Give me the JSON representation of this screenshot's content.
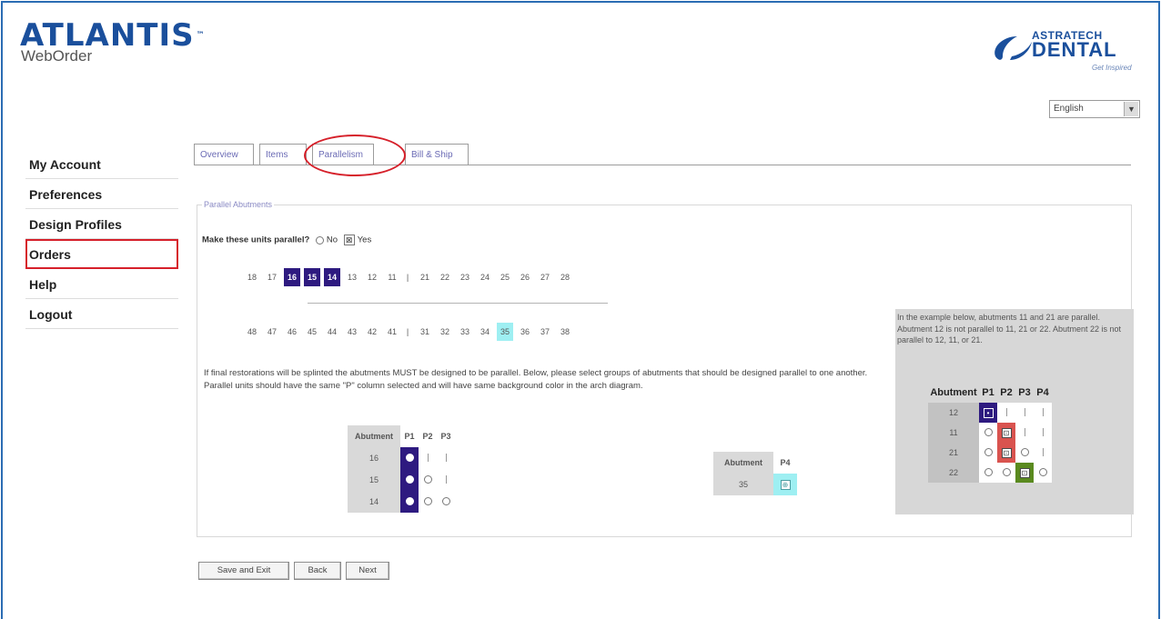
{
  "app": {
    "logo_name": "ATLANTIS",
    "logo_tm": "™",
    "logo_sub": "WebOrder",
    "partner_logo_line1": "ASTRATECH",
    "partner_logo_line2": "DENTAL",
    "partner_logo_tagline": "Get Inspired"
  },
  "language": {
    "selected": "English"
  },
  "sidebar": {
    "items": [
      {
        "label": "My Account"
      },
      {
        "label": "Preferences"
      },
      {
        "label": "Design Profiles"
      },
      {
        "label": "Orders",
        "active": true
      },
      {
        "label": "Help"
      },
      {
        "label": "Logout"
      }
    ]
  },
  "tabs": [
    {
      "label": "Overview"
    },
    {
      "label": "Items"
    },
    {
      "label": "Parallelism",
      "active": true
    },
    {
      "label": "Bill & Ship"
    }
  ],
  "panel": {
    "legend": "Parallel Abutments",
    "question": "Make these units parallel?",
    "option_no": "No",
    "option_yes": "Yes",
    "option_yes_checked": true
  },
  "teeth": {
    "upper": [
      "18",
      "17",
      "16",
      "15",
      "14",
      "13",
      "12",
      "11",
      "|",
      "21",
      "22",
      "23",
      "24",
      "25",
      "26",
      "27",
      "28"
    ],
    "upper_selected": [
      "16",
      "15",
      "14"
    ],
    "lower": [
      "48",
      "47",
      "46",
      "45",
      "44",
      "43",
      "42",
      "41",
      "|",
      "31",
      "32",
      "33",
      "34",
      "35",
      "36",
      "37",
      "38"
    ],
    "lower_selected": [
      "35"
    ]
  },
  "instruction": "If final restorations will be splinted the abutments MUST be designed to be parallel. Below, please select groups of abutments that should be designed parallel to one another. Parallel units should have the same \"P\" column selected and will have same background color in the arch diagram.",
  "grid1": {
    "header": [
      "Abutment",
      "P1",
      "P2",
      "P3"
    ],
    "rows": [
      {
        "abutment": "16"
      },
      {
        "abutment": "15"
      },
      {
        "abutment": "14"
      }
    ]
  },
  "grid2": {
    "header": [
      "Abutment",
      "P4"
    ],
    "rows": [
      {
        "abutment": "35"
      }
    ]
  },
  "example": {
    "text": "In the example below, abutments 11 and 21 are parallel. Abutment 12 is not parallel to 11, 21 or 22. Abutment 22 is not parallel to 12, 11, or 21.",
    "header": [
      "Abutment",
      "P1",
      "P2",
      "P3",
      "P4"
    ],
    "rows": [
      {
        "abutment": "12"
      },
      {
        "abutment": "11"
      },
      {
        "abutment": "21"
      },
      {
        "abutment": "22"
      }
    ],
    "colors": {
      "p1": "#2e1a80",
      "p2": "#d9534f",
      "p3": "#5a8a1f"
    }
  },
  "buttons": {
    "save_exit": "Save and Exit",
    "back": "Back",
    "next": "Next"
  },
  "colors": {
    "frame": "#2a6cb3",
    "highlight": "#d6202a",
    "selected_tooth": "#2e1a80",
    "selected_tooth_p4": "#9eeff2"
  }
}
